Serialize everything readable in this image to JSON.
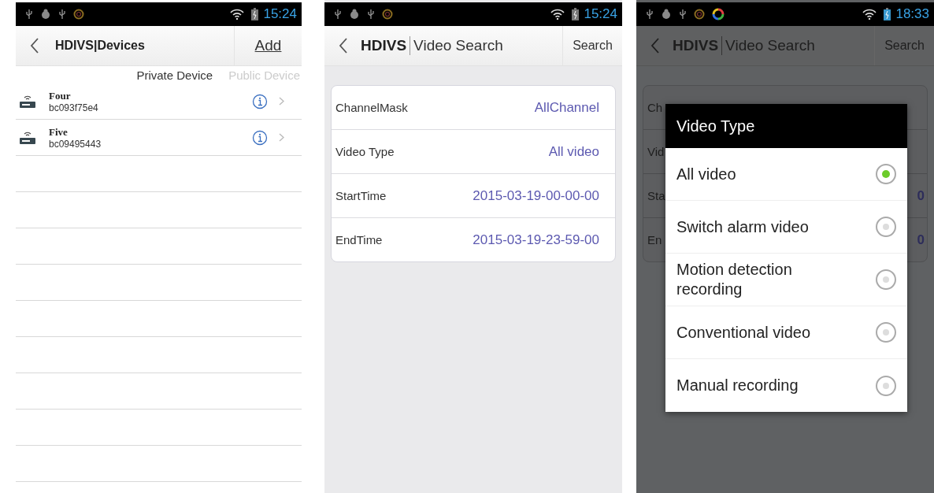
{
  "device_screen": {
    "status_bar": {
      "time": "15:24"
    },
    "header": {
      "title": "HDIVS|Devices",
      "action": "Add"
    },
    "tabs": [
      {
        "label": "Private Device",
        "selected": true
      },
      {
        "label": "Public Device",
        "selected": false
      }
    ],
    "devices": [
      {
        "name": "Four",
        "id": "bc093f75e4"
      },
      {
        "name": "Five",
        "id": "bc09495443"
      }
    ]
  },
  "video_search_screen": {
    "status_bar": {
      "time": "15:24"
    },
    "header": {
      "brand": "HDIVS",
      "title": "Video Search",
      "action": "Search"
    },
    "fields": [
      {
        "label": "ChannelMask",
        "value": "AllChannel"
      },
      {
        "label": "Video Type",
        "value": "All video"
      },
      {
        "label": "StartTime",
        "value": "2015-03-19-00-00-00"
      },
      {
        "label": "EndTime",
        "value": "2015-03-19-23-59-00"
      }
    ]
  },
  "video_type_screen": {
    "status_bar": {
      "time": "18:33"
    },
    "header": {
      "brand": "HDIVS",
      "title": "Video Search",
      "action": "Search"
    },
    "fields_behind": [
      {
        "label": "Ch"
      },
      {
        "label": "Vid"
      },
      {
        "label": "Sta",
        "value": "0"
      },
      {
        "label": "En",
        "value": "0"
      }
    ],
    "dialog": {
      "title": "Video Type",
      "options": [
        {
          "label": "All video",
          "selected": true
        },
        {
          "label": "Switch alarm video",
          "selected": false
        },
        {
          "label": "Motion detection recording",
          "selected": false
        },
        {
          "label": "Conventional video",
          "selected": false
        },
        {
          "label": "Manual recording",
          "selected": false
        }
      ]
    }
  }
}
